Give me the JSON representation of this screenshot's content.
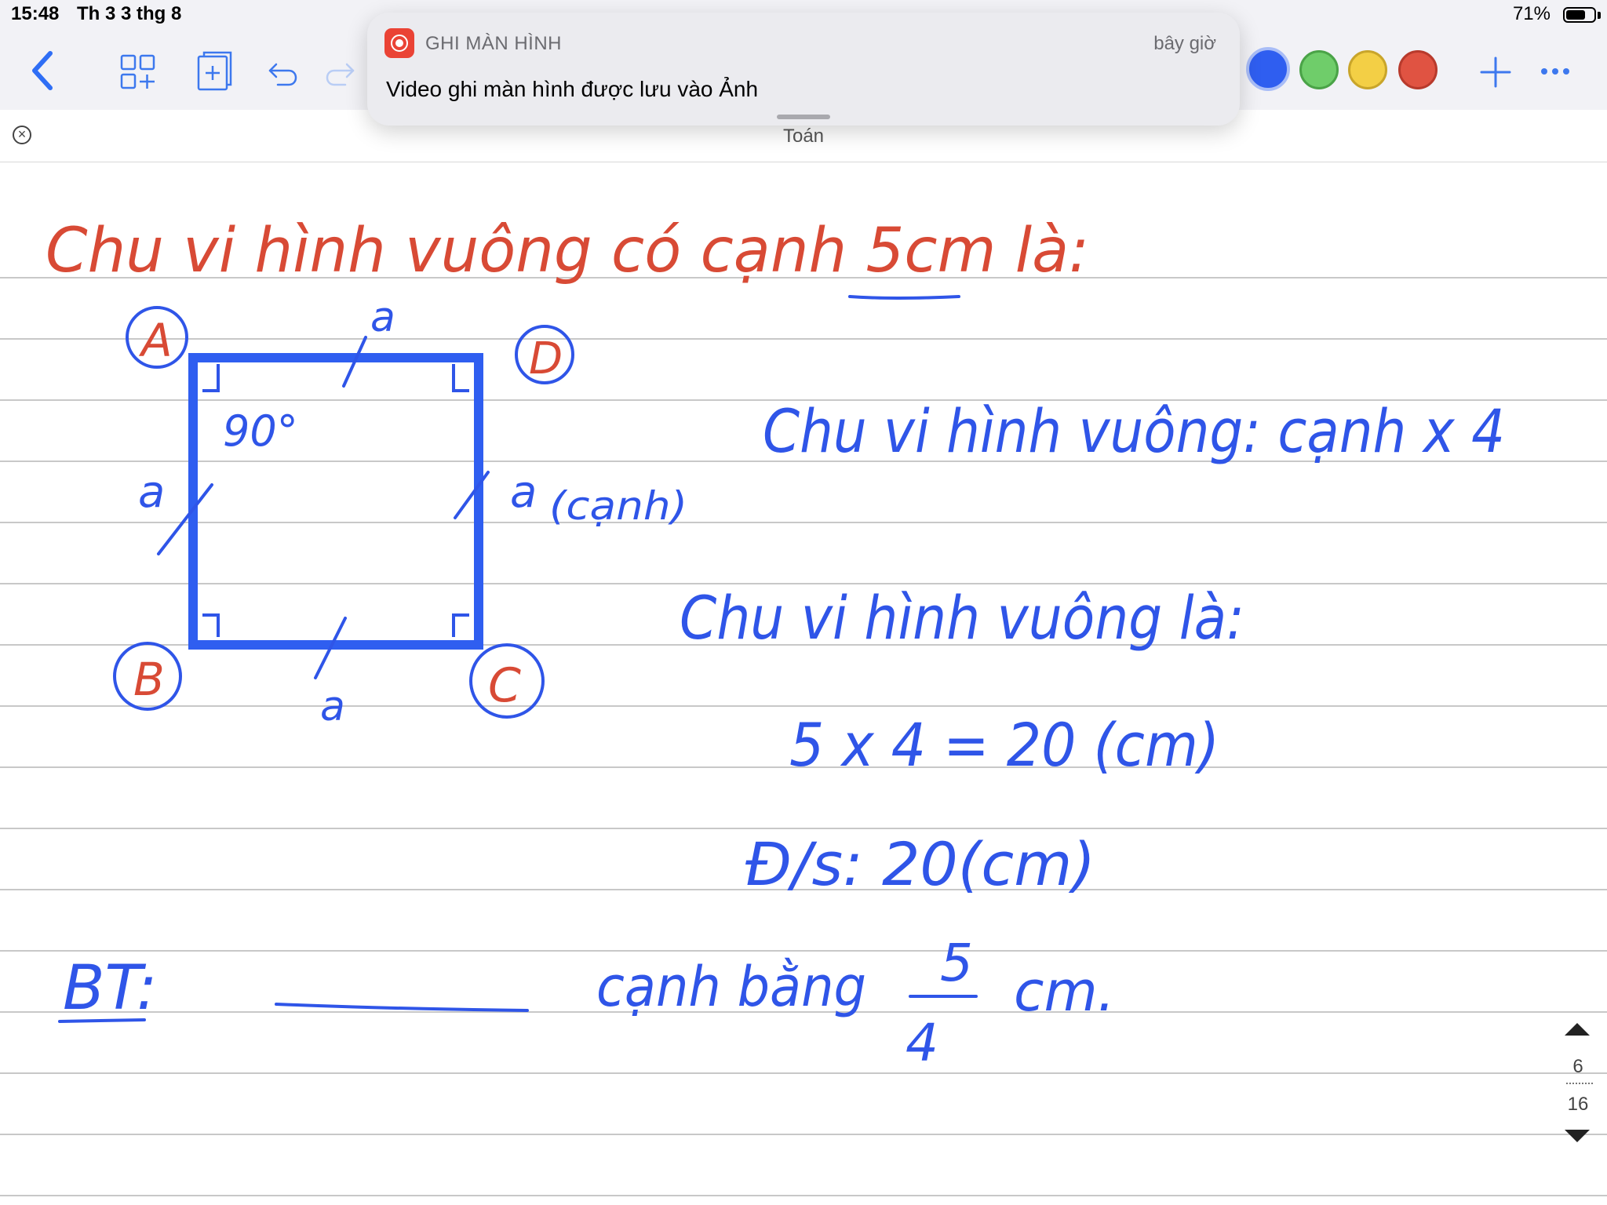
{
  "status_bar": {
    "time": "15:48",
    "date": "Th 3 3 thg 8",
    "battery": "71%",
    "battery_level": 0.71
  },
  "toolbar": {
    "back_icon": "chevron-left-icon",
    "grid_icon": "grid-plus-icon",
    "add_page_icon": "add-page-icon",
    "undo_icon": "undo-icon",
    "redo_icon": "redo-icon",
    "colors": [
      "#2f5ef0",
      "#6fcd6a",
      "#f3cf45",
      "#e05342"
    ],
    "add_icon": "plus-icon",
    "more_icon": "ellipsis-icon"
  },
  "notification": {
    "app": "GHI MÀN HÌNH",
    "time": "bây giờ",
    "message": "Video ghi màn hình được lưu vào Ảnh"
  },
  "document": {
    "title": "Toán",
    "close_icon": "close-circle-icon"
  },
  "pager": {
    "current": "6",
    "total": "16"
  },
  "handwriting": {
    "heading": "Chu vi hình vuông có cạnh 5cm là:",
    "vertex_a": "A",
    "vertex_b": "B",
    "vertex_c": "C",
    "vertex_d": "D",
    "side_label": "a",
    "angle": "90°",
    "side_note": "(cạnh)",
    "formula": "Chu vi hình vuông: cạnh x 4",
    "answer_intro": "Chu vi hình vuông là:",
    "calculation": "5 x 4 = 20 (cm)",
    "result": "Đ/s: 20(cm)",
    "exercise_label": "BT:",
    "exercise_text_before": "cạnh bằng",
    "fraction_numerator": "5",
    "fraction_denominator": "4",
    "exercise_unit": "cm."
  }
}
